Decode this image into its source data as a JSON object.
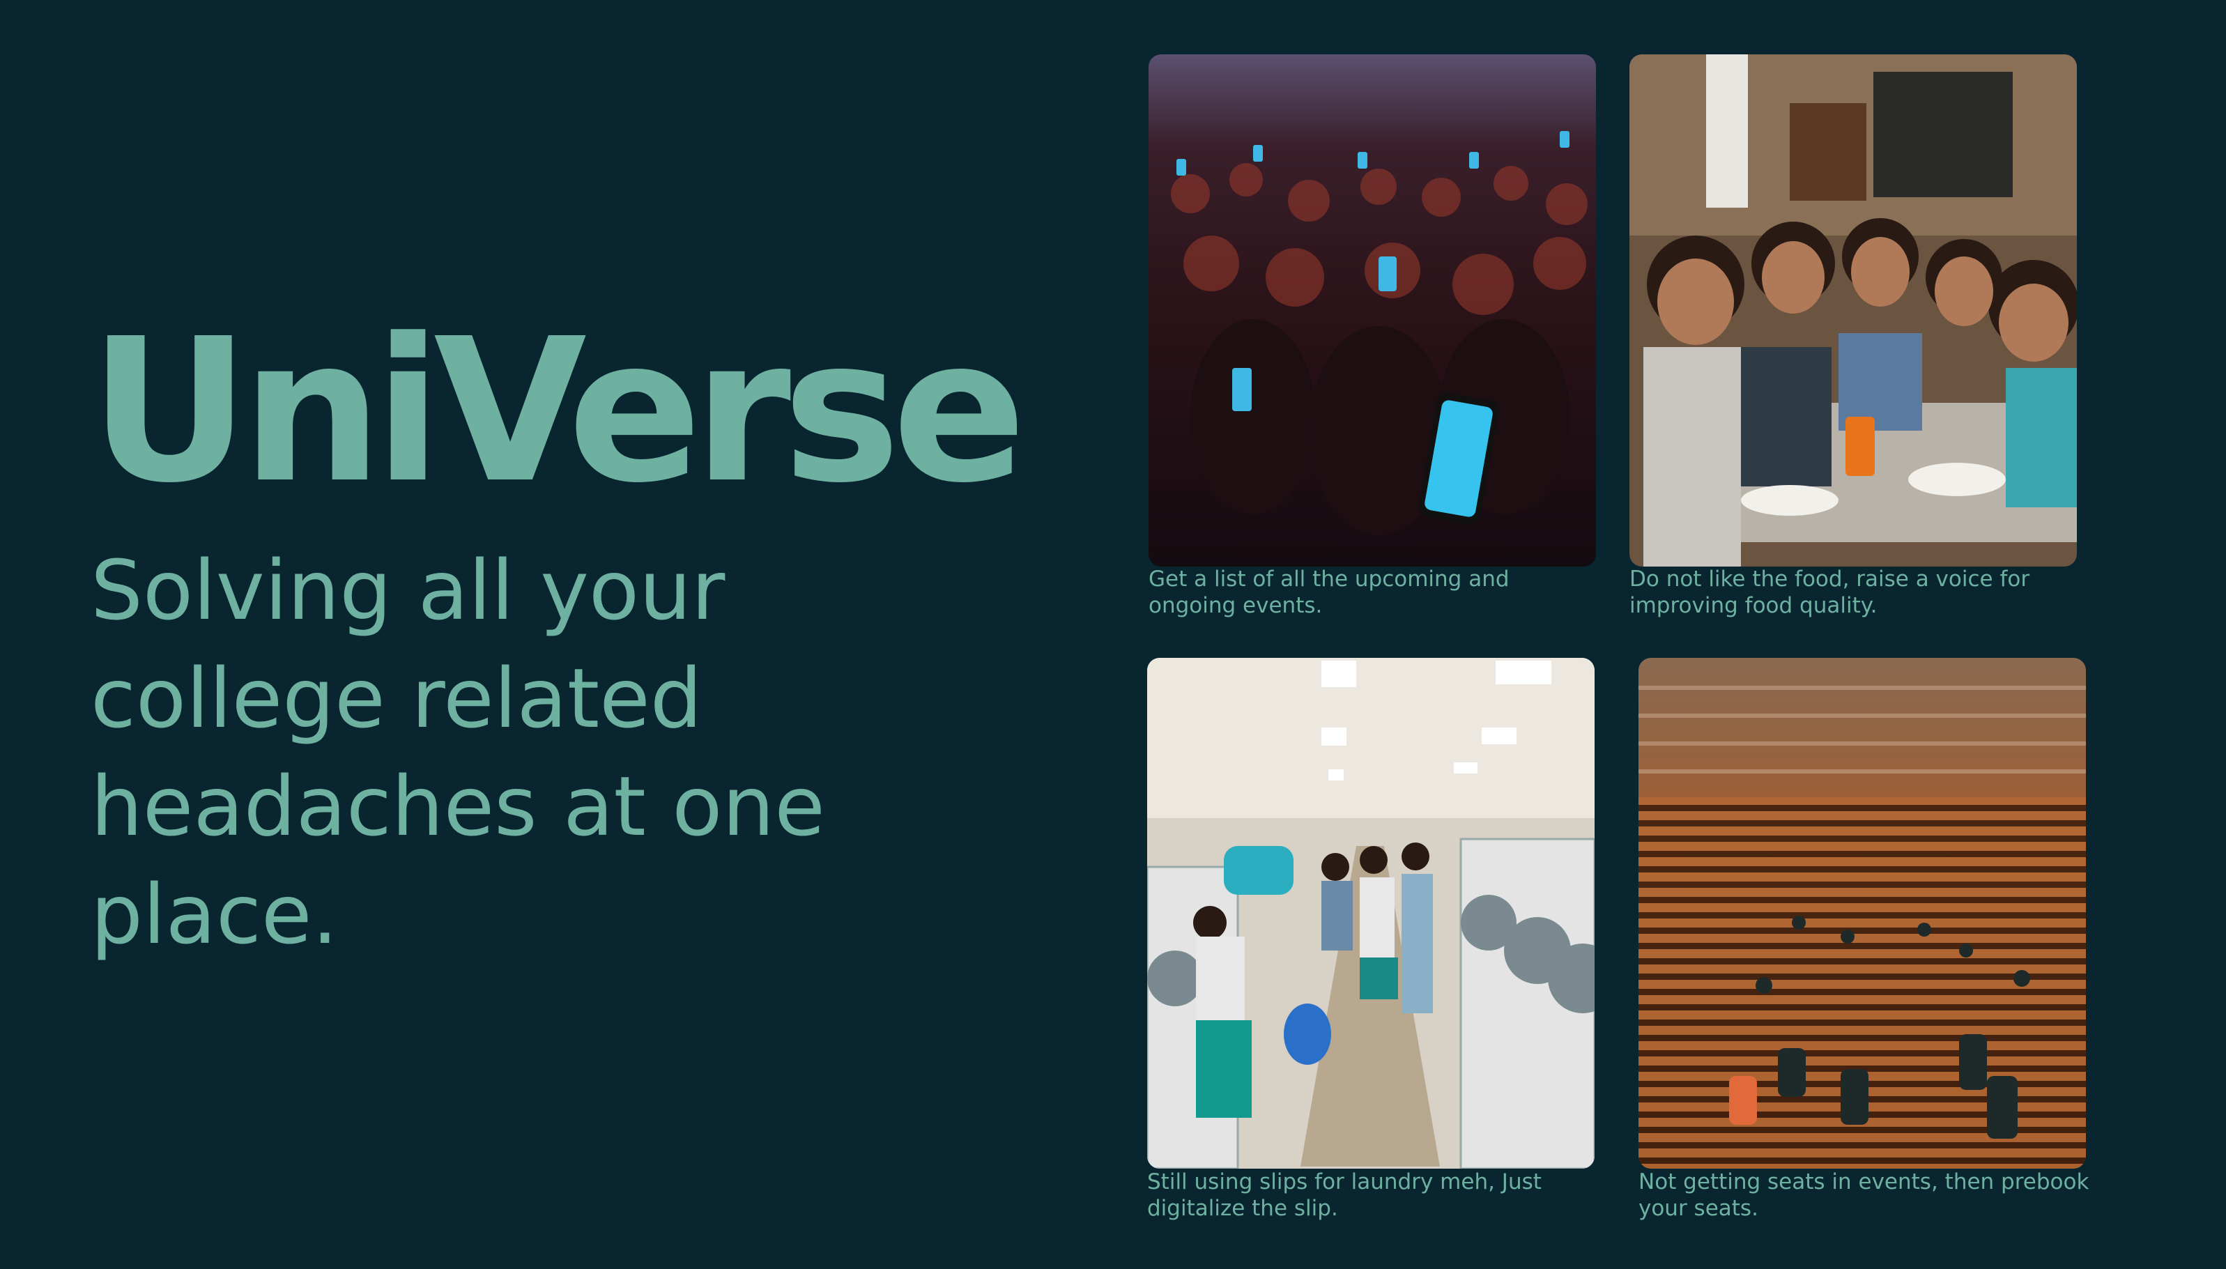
{
  "title": "UniVerse",
  "subtitle": "Solving all your college related headaches at one place.",
  "cards": [
    {
      "caption": "Get a list of all the upcoming and ongoing events."
    },
    {
      "caption": "Do not like the food, raise a voice for improving food quality."
    },
    {
      "caption": "Still using slips for laundry meh, Just digitalize the slip."
    },
    {
      "caption": "Not getting seats in events, then prebook your seats."
    }
  ],
  "colors": {
    "background": "#082530",
    "accent": "#6fb1a1"
  }
}
